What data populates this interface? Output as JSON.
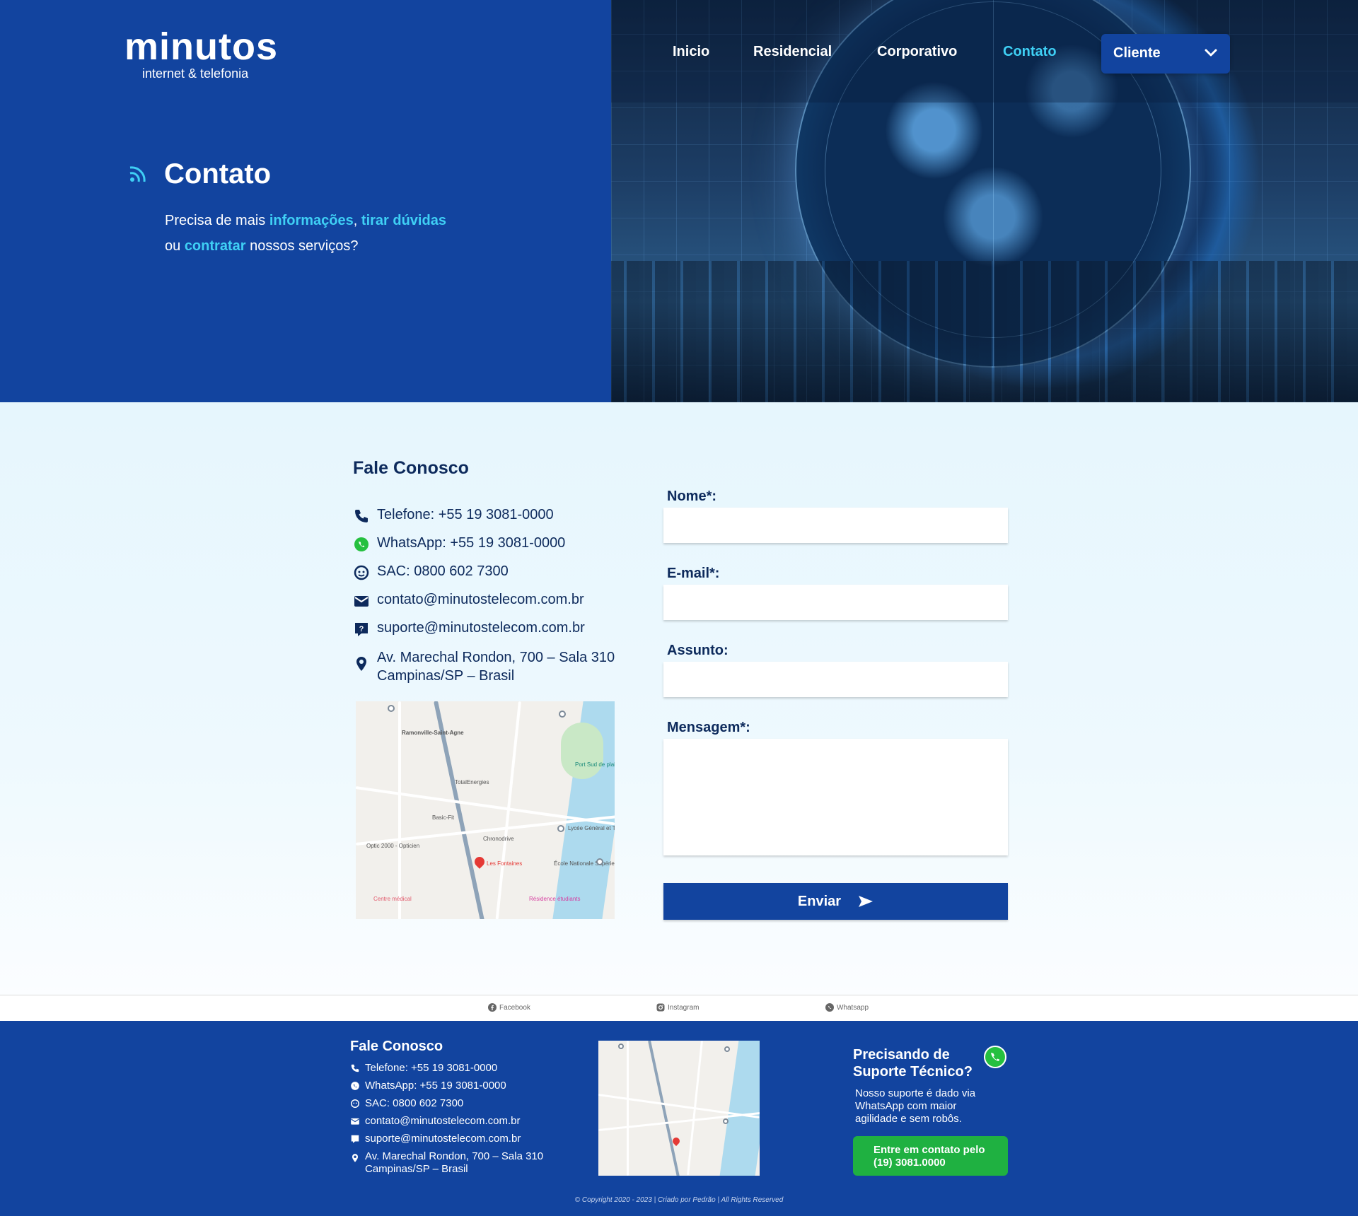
{
  "brand": {
    "name": "minutos",
    "tagline": "internet & telefonia"
  },
  "nav": {
    "items": [
      {
        "label": "Inicio",
        "active": false
      },
      {
        "label": "Residencial",
        "active": false
      },
      {
        "label": "Corporativo",
        "active": false
      },
      {
        "label": "Contato",
        "active": true
      }
    ],
    "client_label": "Cliente"
  },
  "hero": {
    "title": "Contato",
    "text_1": "Precisa de mais ",
    "hl_1": "informações",
    "text_2": ", ",
    "hl_2": "tirar dúvidas",
    "text_3": "ou ",
    "hl_3": "contratar",
    "text_4": " nossos serviços?"
  },
  "contact": {
    "title": "Fale Conosco",
    "phone": "Telefone: +55 19 3081-0000",
    "whatsapp": "WhatsApp: +55 19 3081-0000",
    "sac": "SAC: 0800 602 7300",
    "email": "contato@minutostelecom.com.br",
    "support_email": "suporte@minutostelecom.com.br",
    "address_line1": "Av. Marechal Rondon, 700 – Sala 310",
    "address_line2": "Campinas/SP – Brasil"
  },
  "map_labels": {
    "l1": "Ramonville-Saint-Agne",
    "l2": "TotalEnergies",
    "l3": "Basic-Fit",
    "l4": "Optic 2000 - Opticien",
    "l5": "Lycée Général et Technologique",
    "l6": "École Nationale Supérieure",
    "l7": "Centre médical",
    "l8": "Résidence étudiants",
    "l9": "Port Sud de plaisance",
    "l10": "Chronodrive",
    "l11": "Les Fontaines"
  },
  "form": {
    "name_label": "Nome*:",
    "email_label": "E-mail*:",
    "subject_label": "Assunto:",
    "message_label": "Mensagem*:",
    "name_value": "",
    "email_value": "",
    "subject_value": "",
    "message_value": "",
    "submit_label": "Enviar"
  },
  "social": {
    "facebook": "Facebook",
    "instagram": "Instagram",
    "whatsapp": "Whatsapp"
  },
  "footer": {
    "title": "Fale Conosco",
    "phone": "Telefone: +55 19 3081-0000",
    "whatsapp": "WhatsApp: +55 19 3081-0000",
    "sac": "SAC: 0800 602 7300",
    "email": "contato@minutostelecom.com.br",
    "support_email": "suporte@minutostelecom.com.br",
    "address_line1": "Av. Marechal Rondon, 700 – Sala 310",
    "address_line2": "Campinas/SP – Brasil",
    "support_title_1": "Precisando de",
    "support_title_2": "Suporte Técnico?",
    "support_text": "Nosso suporte é dado via WhatsApp com maior agilidade e sem robôs.",
    "support_btn_1": "Entre em contato pelo",
    "support_btn_2": "(19) 3081.0000",
    "copyright": "© Copyright 2020 - 2023 | Criado por Pedrão | All Rights Reserved"
  },
  "colors": {
    "primary": "#12449f",
    "accent": "#3fd0f5",
    "whatsapp_green": "#1fb141",
    "text_dark": "#0d2a5c"
  },
  "icons": [
    "wifi-signal-icon",
    "chevron-down-icon",
    "phone-icon",
    "whatsapp-icon",
    "headset-icon",
    "mail-icon",
    "support-chat-icon",
    "location-pin-icon",
    "send-arrow-icon",
    "facebook-icon",
    "instagram-icon"
  ]
}
